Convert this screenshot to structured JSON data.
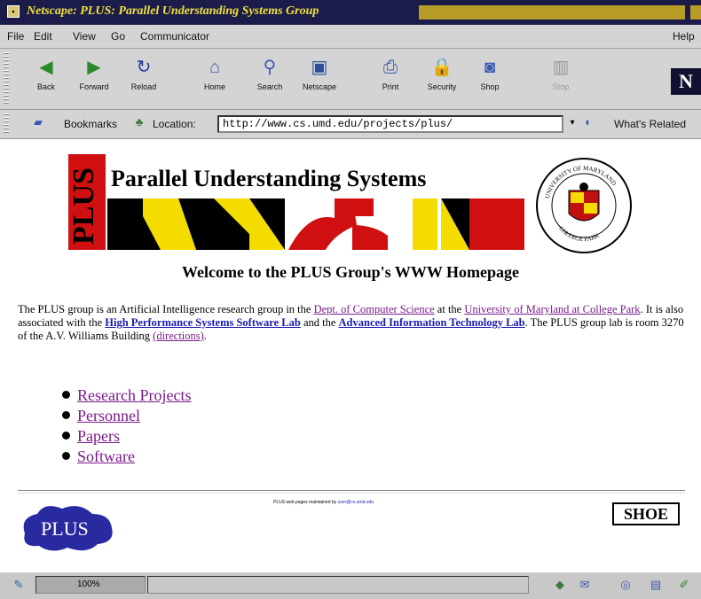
{
  "window": {
    "title": "Netscape: PLUS: Parallel Understanding Systems Group"
  },
  "menu": [
    "File",
    "Edit",
    "View",
    "Go",
    "Communicator",
    "Help"
  ],
  "toolbar": {
    "buttons": [
      {
        "label": "Back"
      },
      {
        "label": "Forward"
      },
      {
        "label": "Reload"
      },
      {
        "label": "Home"
      },
      {
        "label": "Search"
      },
      {
        "label": "Netscape"
      },
      {
        "label": "Print"
      },
      {
        "label": "Security"
      },
      {
        "label": "Shop"
      },
      {
        "label": "Stop"
      }
    ],
    "logo": "N"
  },
  "locationbar": {
    "bookmarks_label": "Bookmarks",
    "location_label": "Location:",
    "url": "http://www.cs.umd.edu/projects/plus/",
    "whats_related": "What's Related"
  },
  "page": {
    "banner": {
      "title": "Parallel Understanding Systems",
      "side_text": "PLUS"
    },
    "seal": {
      "top_text": "UNIVERSITY OF MARYLAND",
      "bottom_text": "COLLEGE PARK"
    },
    "welcome": "Welcome to the PLUS Group's WWW Homepage",
    "para": {
      "t1": "The PLUS group is an Artificial Intelligence research group in the ",
      "l1": "Dept. of Computer Science",
      "t2": " at the ",
      "l2": "University of Maryland at College Park",
      "t3": ". It is also associated with the ",
      "l3": "High Performance Systems Software Lab",
      "t4": " and the ",
      "l4": "Advanced Information Technology Lab",
      "t5": ". The PLUS group lab is room 3270 of the A.V. Williams Building ",
      "l5": "(directions)",
      "t6": "."
    },
    "links": [
      "Research Projects",
      "Personnel",
      "Papers",
      "Software"
    ],
    "footer": {
      "note_text": "PLUS web pages maintained by ",
      "note_link": "user@cs.umd.edu",
      "logo_text": "PLUS",
      "shoe": "SHOE"
    }
  },
  "status": {
    "progress": "100%"
  }
}
